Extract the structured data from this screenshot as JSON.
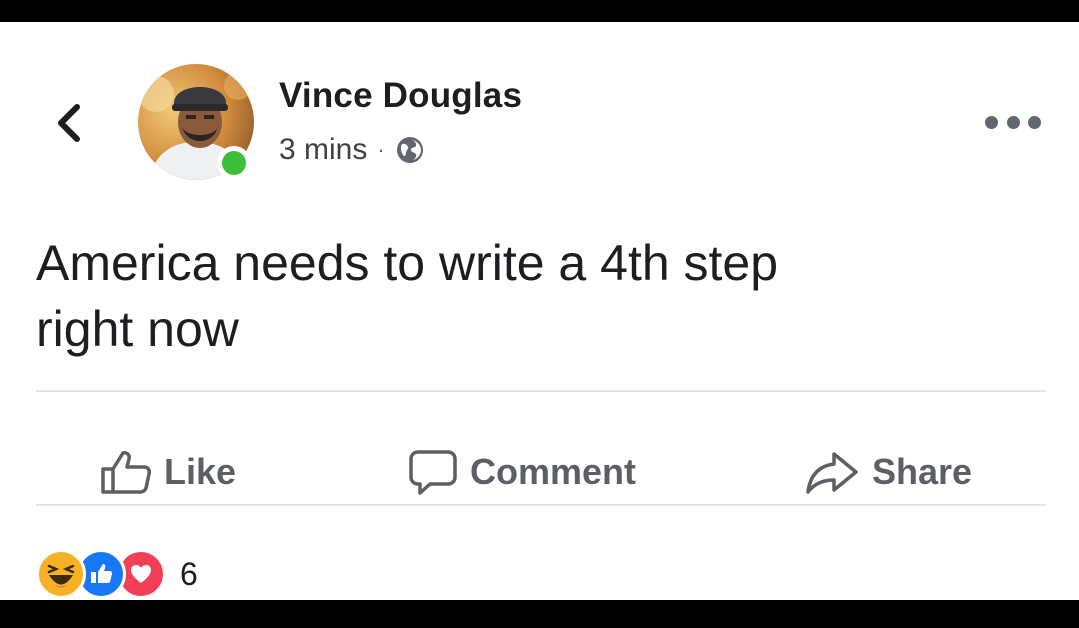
{
  "post": {
    "author": "Vince Douglas",
    "time": "3 mins",
    "separator": "·",
    "text_line1": "America needs to write a 4th step",
    "text_line2": "right now"
  },
  "actions": {
    "like_label": "Like",
    "comment_label": "Comment",
    "share_label": "Share"
  },
  "reactions": {
    "icons": [
      "haha-icon",
      "like-reaction-icon",
      "love-reaction-icon"
    ],
    "count": "6"
  },
  "icons": {
    "back": "chevron-left-icon",
    "privacy": "globe-icon",
    "more": "more-options-icon"
  },
  "colors": {
    "like_blue": "#1877f2",
    "love_red": "#f33e58",
    "haha_yellow": "#f7b125",
    "online_green": "#3bbf3a"
  }
}
